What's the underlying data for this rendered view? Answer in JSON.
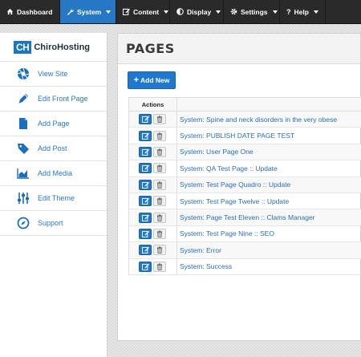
{
  "topbar": {
    "menus": [
      {
        "label": "Dashboard",
        "icon": "home-icon"
      },
      {
        "label": "System",
        "icon": "wrench-icon",
        "active": true
      },
      {
        "label": "Content",
        "icon": "edit-icon"
      },
      {
        "label": "Display",
        "icon": "contrast-icon"
      },
      {
        "label": "Settings",
        "icon": "gear-icon"
      },
      {
        "label": "Help",
        "icon": "question-icon"
      }
    ]
  },
  "sidebar": {
    "brand_mark": "CH",
    "brand_name": "ChiroHosting",
    "items": [
      {
        "label": "View Site",
        "icon": "aperture-icon"
      },
      {
        "label": "Edit Front Page",
        "icon": "pencil-icon"
      },
      {
        "label": "Add Page",
        "icon": "document-icon"
      },
      {
        "label": "Add Post",
        "icon": "tag-icon"
      },
      {
        "label": "Add Media",
        "icon": "area-chart-icon"
      },
      {
        "label": "Edit Theme",
        "icon": "sliders-icon"
      },
      {
        "label": "Support",
        "icon": "compass-icon"
      }
    ]
  },
  "main": {
    "title": "PAGES",
    "add_button": "Add New",
    "table": {
      "header_actions": "Actions",
      "rows": [
        "System: Spine and neck disorders in the very obese",
        "System: PUBLISH DATE PAGE TEST",
        "System: User Page One",
        "System: QA Test Page :: Update",
        "System: Test Page Quadro :: Update",
        "System: Test Page Twelve :: Update",
        "System: Page Test Eleven :: Clams Manager",
        "System: Test Page Nine :: SEO",
        "System: Error",
        "System: Success"
      ]
    }
  },
  "colors": {
    "topbar": "#2a2a2a",
    "accent": "#2778c4",
    "button": "#1e78d0"
  }
}
